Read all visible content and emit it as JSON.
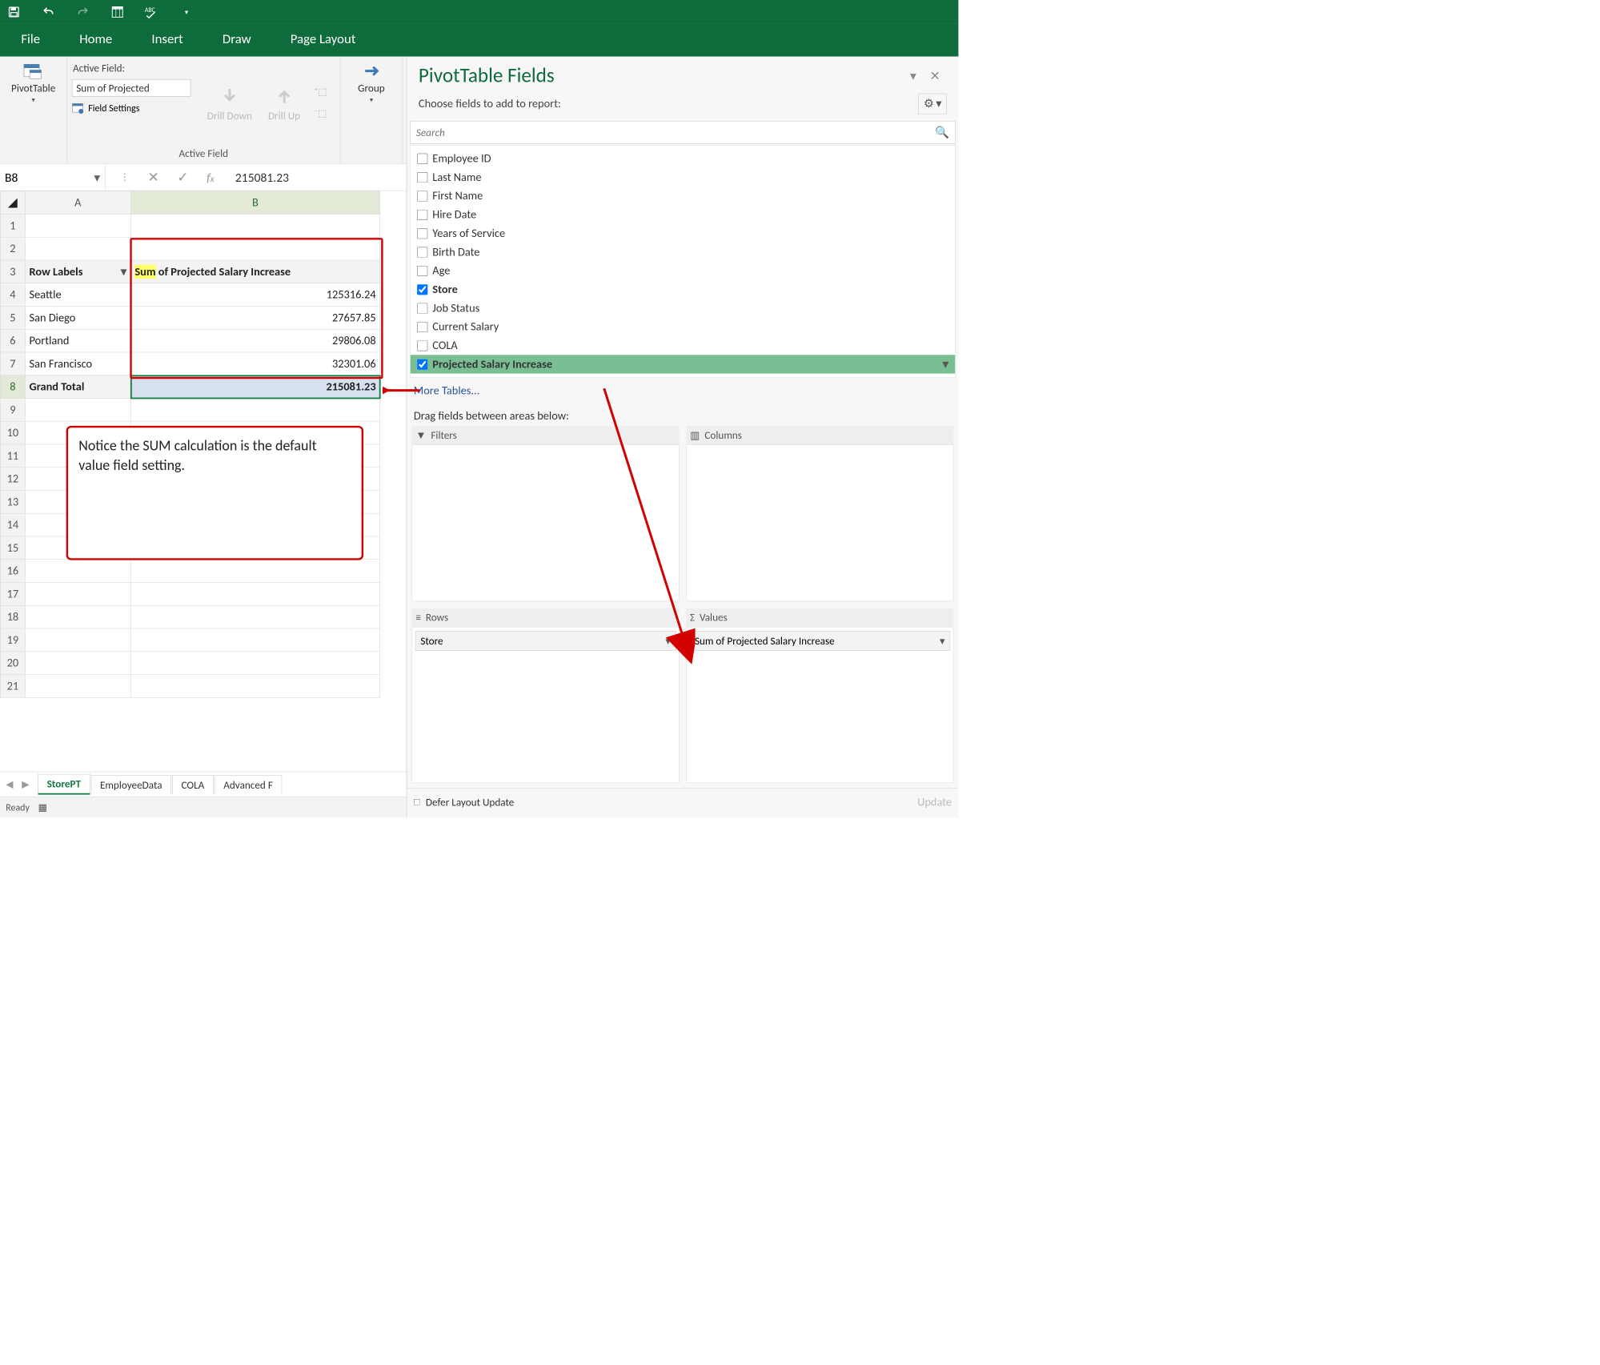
{
  "qat": {
    "icons": [
      "save",
      "undo",
      "redo",
      "pivot-table",
      "spellcheck",
      "customize"
    ]
  },
  "ribbonTabs": [
    "File",
    "Home",
    "Insert",
    "Draw",
    "Page Layout"
  ],
  "ribbon": {
    "pivotTable": "PivotTable",
    "activeFieldLabel": "Active Field:",
    "activeFieldValue": "Sum of Projected",
    "fieldSettings": "Field Settings",
    "drillDown": "Drill Down",
    "drillUp": "Drill Up",
    "group": "Group",
    "groupLabel": "Active Field"
  },
  "nameBox": "B8",
  "formulaValue": "215081.23",
  "sheet": {
    "colHeaders": [
      "A",
      "B"
    ],
    "headerRow": 3,
    "a3": "Row Labels",
    "b3_prefix": "Sum",
    "b3_rest": " of Projected Salary Increase",
    "rows": [
      {
        "a": "Seattle",
        "b": "125316.24"
      },
      {
        "a": "San Diego",
        "b": "27657.85"
      },
      {
        "a": "Portland",
        "b": "29806.08"
      },
      {
        "a": "San Francisco",
        "b": "32301.06"
      }
    ],
    "grandTotalLabel": "Grand Total",
    "grandTotalValue": "215081.23",
    "callout": "Notice the SUM calculation is the default value field setting."
  },
  "sheetTabs": [
    "StorePT",
    "EmployeeData",
    "COLA",
    "Advanced F"
  ],
  "statusText": "Ready",
  "panel": {
    "title": "PivotTable Fields",
    "subtitle": "Choose fields to add to report:",
    "searchPlaceholder": "Search",
    "fields": [
      {
        "name": "Employee ID",
        "checked": false
      },
      {
        "name": "Last Name",
        "checked": false
      },
      {
        "name": "First Name",
        "checked": false
      },
      {
        "name": "Hire Date",
        "checked": false
      },
      {
        "name": "Years of Service",
        "checked": false
      },
      {
        "name": "Birth Date",
        "checked": false
      },
      {
        "name": "Age",
        "checked": false
      },
      {
        "name": "Store",
        "checked": true
      },
      {
        "name": "Job Status",
        "checked": false
      },
      {
        "name": "Current Salary",
        "checked": false
      },
      {
        "name": "COLA",
        "checked": false
      },
      {
        "name": "Projected Salary Increase",
        "checked": true,
        "highlight": true
      }
    ],
    "moreTables": "More Tables...",
    "areaInstruction": "Drag fields between areas below:",
    "filters": "Filters",
    "columns": "Columns",
    "rowsLbl": "Rows",
    "valuesLbl": "Values",
    "rowChip": "Store",
    "valueChip": "Sum of Projected Salary Increase",
    "deferLabel": "Defer Layout Update",
    "updateLabel": "Update"
  }
}
